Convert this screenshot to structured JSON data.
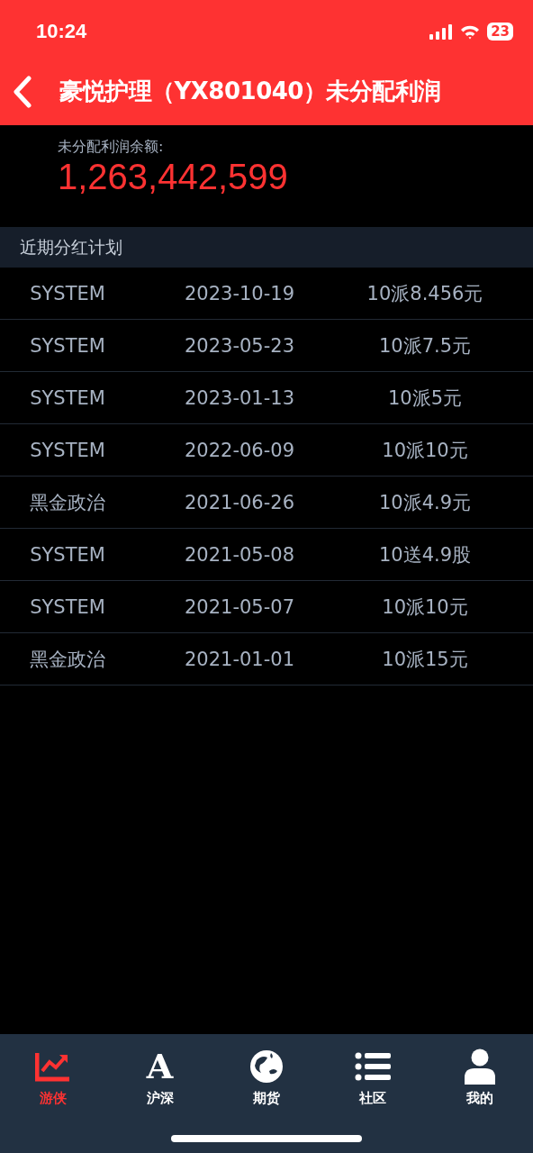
{
  "status_bar": {
    "time": "10:24",
    "battery": "23"
  },
  "header": {
    "title": "豪悦护理（YX801040）未分配利润"
  },
  "balance": {
    "label": "未分配利润余额:",
    "value": "1,263,442,599"
  },
  "section": {
    "title": "近期分红计划"
  },
  "rows": [
    {
      "source": "SYSTEM",
      "date": "2023-10-19",
      "plan": "10派8.456元"
    },
    {
      "source": "SYSTEM",
      "date": "2023-05-23",
      "plan": "10派7.5元"
    },
    {
      "source": "SYSTEM",
      "date": "2023-01-13",
      "plan": "10派5元"
    },
    {
      "source": "SYSTEM",
      "date": "2022-06-09",
      "plan": "10派10元"
    },
    {
      "source": "黑金政治",
      "date": "2021-06-26",
      "plan": "10派4.9元"
    },
    {
      "source": "SYSTEM",
      "date": "2021-05-08",
      "plan": "10送4.9股"
    },
    {
      "source": "SYSTEM",
      "date": "2021-05-07",
      "plan": "10派10元"
    },
    {
      "source": "黑金政治",
      "date": "2021-01-01",
      "plan": "10派15元"
    }
  ],
  "tabs": [
    {
      "kind": "chart",
      "label": "游侠",
      "selected": true
    },
    {
      "kind": "letter",
      "glyph": "A",
      "label": "沪深",
      "selected": false
    },
    {
      "kind": "globe",
      "label": "期货",
      "selected": false
    },
    {
      "kind": "list",
      "label": "社区",
      "selected": false
    },
    {
      "kind": "person",
      "label": "我的",
      "selected": false
    }
  ]
}
